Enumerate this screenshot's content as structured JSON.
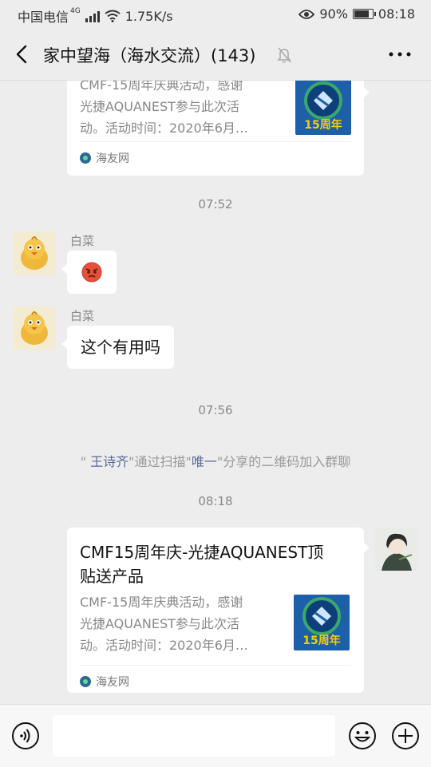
{
  "status_bar": {
    "carrier": "中国电信",
    "network": "4G",
    "speed": "1.75K/s",
    "battery": "90%",
    "battery_level": 0.9,
    "time": "08:18"
  },
  "header": {
    "title": "家中望海（海水交流）(143)"
  },
  "messages": {
    "card_top": {
      "desc_lines": [
        "CMF-15周年庆典活动，感谢",
        "光捷AQUANEST参与此次活",
        "动。活动时间：2020年6月…"
      ],
      "thumb_text": "15周年",
      "source": "海友网"
    },
    "time1": "07:52",
    "msg1": {
      "sender": "白菜",
      "emoji": "😡"
    },
    "msg2": {
      "sender": "白菜",
      "text": "这个有用吗"
    },
    "time2": "07:56",
    "system": {
      "quote_open": "\"",
      "name1": "王诗齐",
      "mid": "\"通过扫描\"",
      "name2": "唯一",
      "end": "\"分享的二维码加入群聊"
    },
    "time3": "08:18",
    "card_bottom": {
      "title_lines": [
        "CMF15周年庆-光捷AQUANEST顶",
        "贴送产品"
      ],
      "desc_lines": [
        "CMF-15周年庆典活动，感谢",
        "光捷AQUANEST参与此次活",
        "动。活动时间：2020年6月…"
      ],
      "thumb_text": "15周年",
      "source": "海友网"
    }
  },
  "icons": {
    "back": "back-arrow-icon",
    "mute": "bell-off-icon",
    "more": "more-dots-icon",
    "voice": "voice-icon",
    "emoji": "emoji-icon",
    "plus": "plus-icon"
  }
}
